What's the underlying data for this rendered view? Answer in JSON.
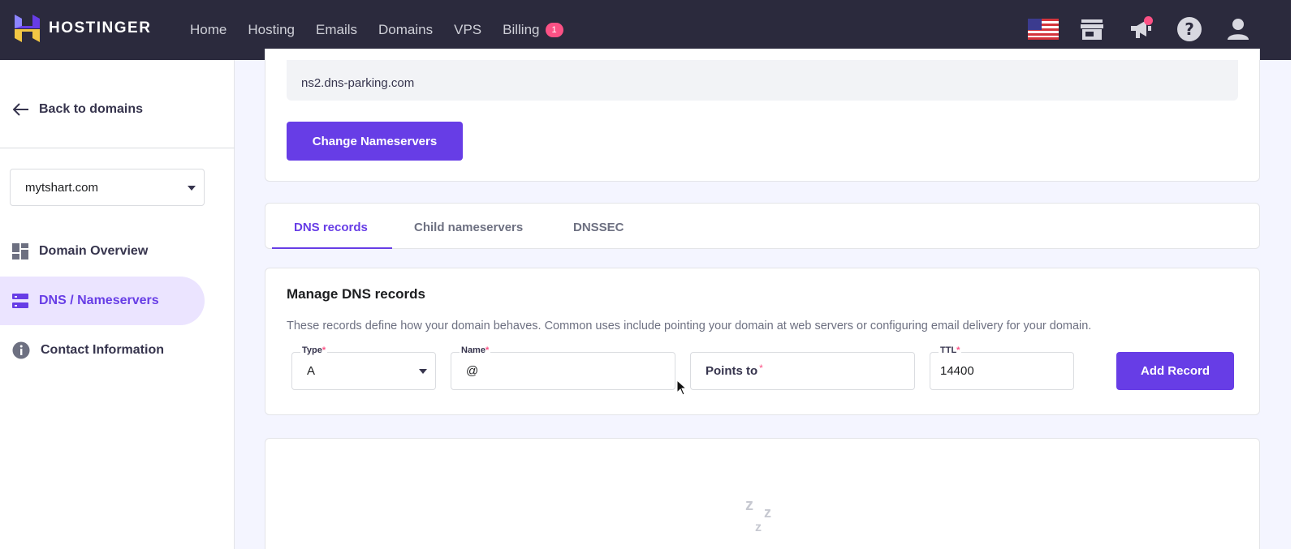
{
  "brand": {
    "name": "HOSTINGER",
    "colors": {
      "topbar": "#2b2a3d",
      "primary": "#673de6",
      "badge": "#fc5185"
    }
  },
  "nav": [
    {
      "label": "Home"
    },
    {
      "label": "Hosting"
    },
    {
      "label": "Emails"
    },
    {
      "label": "Domains"
    },
    {
      "label": "VPS"
    },
    {
      "label": "Billing",
      "badge": "1"
    }
  ],
  "top_icons": [
    "us-flag-icon",
    "store-icon",
    "announcement-icon",
    "help-icon",
    "account-icon"
  ],
  "sidebar": {
    "back_label": "Back to domains",
    "domain_selected": "mytshart.com",
    "items": [
      {
        "label": "Domain Overview",
        "icon": "dashboard-icon"
      },
      {
        "label": "DNS / Nameservers",
        "icon": "dns-icon",
        "active": true
      },
      {
        "label": "Contact Information",
        "icon": "info-icon"
      }
    ]
  },
  "nameservers": {
    "ns2": "ns2.dns-parking.com",
    "change_button": "Change Nameservers"
  },
  "tabs": [
    {
      "label": "DNS records",
      "active": true
    },
    {
      "label": "Child nameservers"
    },
    {
      "label": "DNSSEC"
    }
  ],
  "manage": {
    "title": "Manage DNS records",
    "description": "These records define how your domain behaves. Common uses include pointing your domain at web servers or configuring email delivery for your domain.",
    "type_label": "Type",
    "type_value": "A",
    "name_label": "Name",
    "name_value": "@",
    "points_placeholder": "Points to",
    "ttl_label": "TTL",
    "ttl_value": "14400",
    "add_button": "Add Record",
    "required_mark": "*"
  },
  "empty_state": {
    "glyph": "z"
  }
}
